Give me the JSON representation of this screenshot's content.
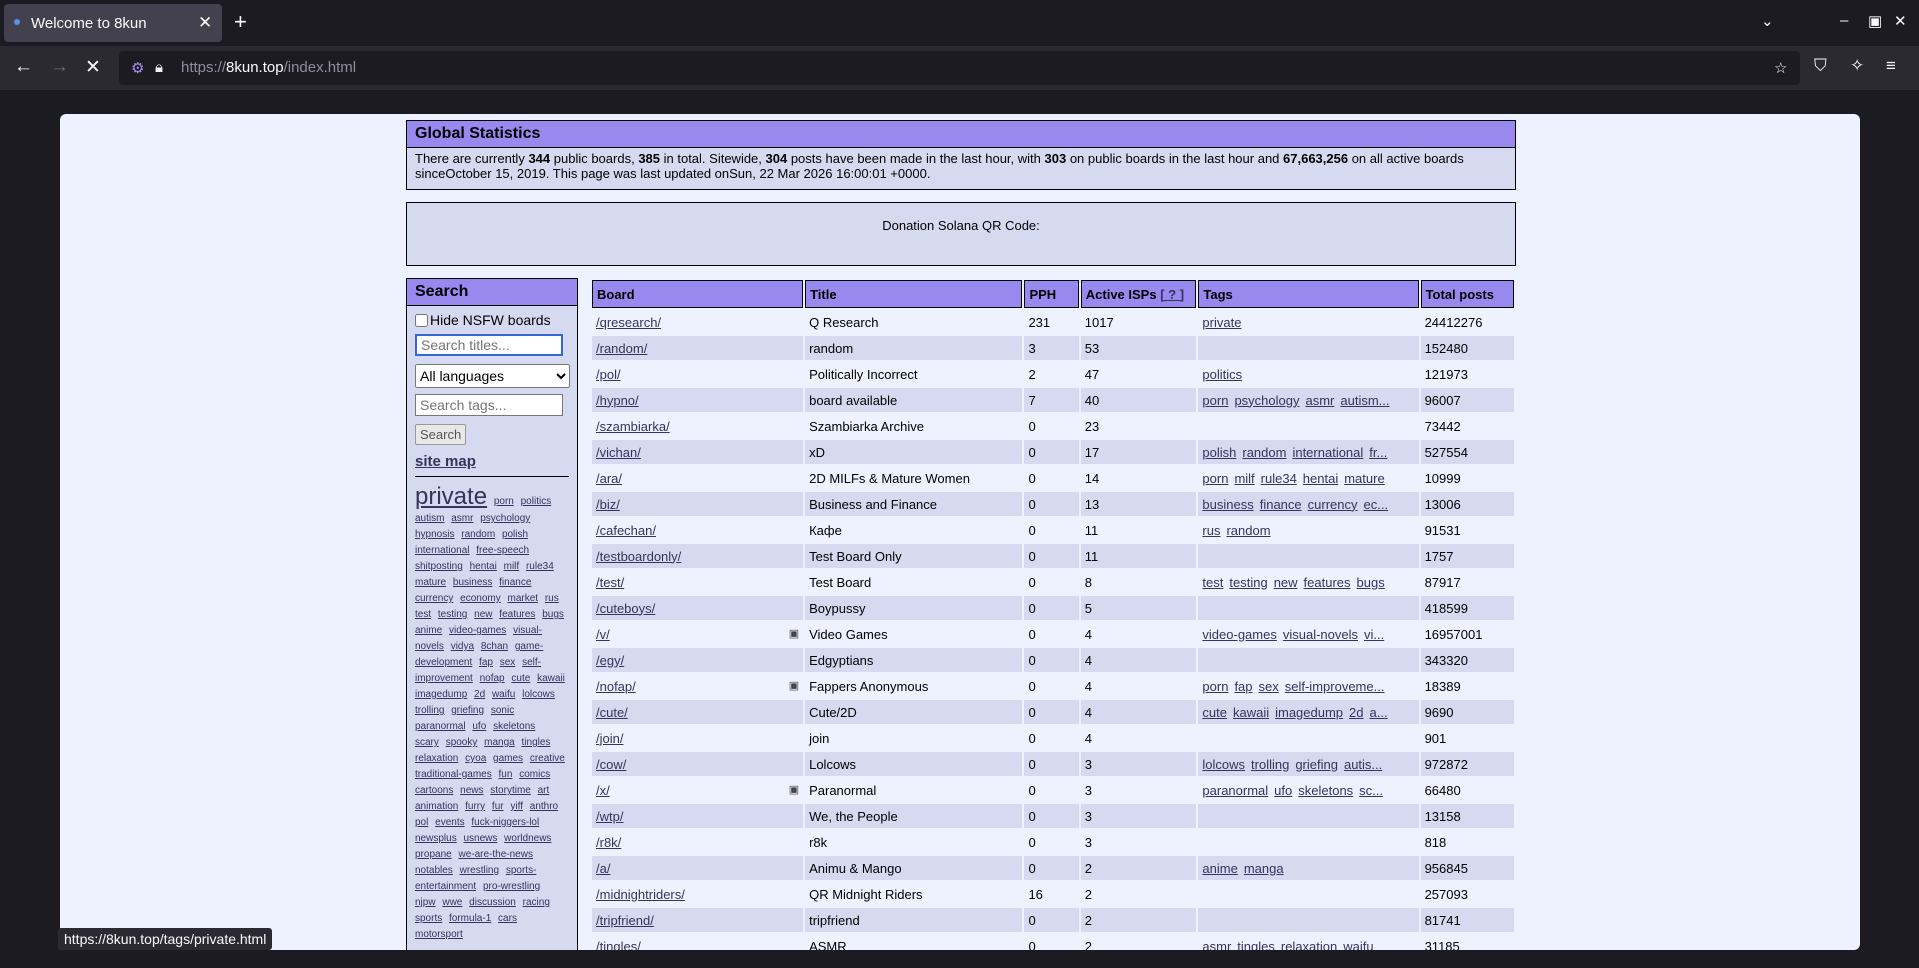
{
  "browser": {
    "tab_title": "Welcome to 8kun",
    "url_prefix": "https://",
    "url_host": "8kun.top",
    "url_path": "/index.html",
    "status_url": "https://8kun.top/tags/private.html"
  },
  "stats": {
    "heading": "Global Statistics",
    "t1": "There are currently ",
    "public_boards": "344",
    "t2": " public boards, ",
    "total_boards": "385",
    "t3": " in total. Sitewide, ",
    "posts_hour": "304",
    "t4": " posts have been made in the last hour, with ",
    "public_hour": "303",
    "t5": " on public boards in the last hour and ",
    "all_posts": "67,663,256",
    "t6": " on all active boards sinceOctober 15, 2019. This page was last updated onSun, 22 Mar 2026 16:00:01 +0000."
  },
  "donation": {
    "text": "Donation Solana QR Code:"
  },
  "search": {
    "heading": "Search",
    "hide_nsfw": "Hide NSFW boards",
    "title_placeholder": "Search titles...",
    "language": "All languages",
    "tags_placeholder": "Search tags...",
    "button": "Search",
    "site_map": "site map",
    "tags": [
      "porn",
      "politics",
      "autism",
      "asmr",
      "psychology",
      "hypnosis",
      "random",
      "polish",
      "international",
      "free-speech",
      "shitposting",
      "hentai",
      "milf",
      "rule34",
      "mature",
      "business",
      "finance",
      "currency",
      "economy",
      "market",
      "rus",
      "test",
      "testing",
      "new",
      "features",
      "bugs",
      "anime",
      "video-games",
      "visual-novels",
      "vidya",
      "8chan",
      "game-development",
      "fap",
      "sex",
      "self-improvement",
      "nofap",
      "cute",
      "kawaii",
      "imagedump",
      "2d",
      "waifu",
      "lolcows",
      "trolling",
      "griefing",
      "sonic",
      "paranormal",
      "ufo",
      "skeletons",
      "scary",
      "spooky",
      "manga",
      "tingles",
      "relaxation",
      "cyoa",
      "games",
      "creative",
      "traditional-games",
      "fun",
      "comics",
      "cartoons",
      "news",
      "storytime",
      "art",
      "animation",
      "furry",
      "fur",
      "yiff",
      "anthro",
      "pol",
      "events",
      "fuck-niggers-lol",
      "newsplus",
      "usnews",
      "worldnews",
      "propane",
      "we-are-the-news",
      "notables",
      "wrestling",
      "sports-entertainment",
      "pro-wrestling",
      "njpw",
      "wwe",
      "discussion",
      "racing",
      "sports",
      "formula-1",
      "cars",
      "motorsport"
    ],
    "big_tag": "private"
  },
  "table": {
    "headers": [
      "Board",
      "Title",
      "PPH",
      "Active ISPs",
      "Tags",
      "Total posts"
    ],
    "isp_help": "[ ? ]",
    "rows": [
      {
        "board": "/qresearch/",
        "title": "Q Research",
        "pph": "231",
        "isps": "1017",
        "tags": [
          "private"
        ],
        "posts": "24412276"
      },
      {
        "board": "/random/",
        "title": "random",
        "pph": "3",
        "isps": "53",
        "tags": [],
        "posts": "152480"
      },
      {
        "board": "/pol/",
        "title": "Politically Incorrect",
        "pph": "2",
        "isps": "47",
        "tags": [
          "politics"
        ],
        "posts": "121973"
      },
      {
        "board": "/hypno/",
        "title": "board available",
        "pph": "7",
        "isps": "40",
        "tags": [
          "porn",
          "psychology",
          "asmr",
          "autism..."
        ],
        "posts": "96007"
      },
      {
        "board": "/szambiarka/",
        "title": "Szambiarka Archive",
        "pph": "0",
        "isps": "23",
        "tags": [],
        "posts": "73442"
      },
      {
        "board": "/vichan/",
        "title": "xD",
        "pph": "0",
        "isps": "17",
        "tags": [
          "polish",
          "random",
          "international",
          "fr..."
        ],
        "posts": "527554"
      },
      {
        "board": "/ara/",
        "title": "2D MILFs & Mature Women",
        "pph": "0",
        "isps": "14",
        "tags": [
          "porn",
          "milf",
          "rule34",
          "hentai",
          "mature"
        ],
        "posts": "10999"
      },
      {
        "board": "/biz/",
        "title": "Business and Finance",
        "pph": "0",
        "isps": "13",
        "tags": [
          "business",
          "finance",
          "currency",
          "ec..."
        ],
        "posts": "13006"
      },
      {
        "board": "/cafechan/",
        "title": "Кафе",
        "pph": "0",
        "isps": "11",
        "tags": [
          "rus",
          "random"
        ],
        "posts": "91531"
      },
      {
        "board": "/testboardonly/",
        "title": "Test Board Only",
        "pph": "0",
        "isps": "11",
        "tags": [],
        "posts": "1757"
      },
      {
        "board": "/test/",
        "title": "Test Board",
        "pph": "0",
        "isps": "8",
        "tags": [
          "test",
          "testing",
          "new",
          "features",
          "bugs"
        ],
        "posts": "87917"
      },
      {
        "board": "/cuteboys/",
        "title": "Boypussy",
        "pph": "0",
        "isps": "5",
        "tags": [],
        "posts": "418599"
      },
      {
        "board": "/v/",
        "title": "Video Games",
        "pph": "0",
        "isps": "4",
        "tags": [
          "video-games",
          "visual-novels",
          "vi..."
        ],
        "posts": "16957001",
        "sfw": true
      },
      {
        "board": "/egy/",
        "title": "Edgyptians",
        "pph": "0",
        "isps": "4",
        "tags": [],
        "posts": "343320"
      },
      {
        "board": "/nofap/",
        "title": "Fappers Anonymous",
        "pph": "0",
        "isps": "4",
        "tags": [
          "porn",
          "fap",
          "sex",
          "self-improveme..."
        ],
        "posts": "18389",
        "sfw": true
      },
      {
        "board": "/cute/",
        "title": "Cute/2D",
        "pph": "0",
        "isps": "4",
        "tags": [
          "cute",
          "kawaii",
          "imagedump",
          "2d",
          "a..."
        ],
        "posts": "9690"
      },
      {
        "board": "/join/",
        "title": "join",
        "pph": "0",
        "isps": "4",
        "tags": [],
        "posts": "901"
      },
      {
        "board": "/cow/",
        "title": "Lolcows",
        "pph": "0",
        "isps": "3",
        "tags": [
          "lolcows",
          "trolling",
          "griefing",
          "autis..."
        ],
        "posts": "972872"
      },
      {
        "board": "/x/",
        "title": "Paranormal",
        "pph": "0",
        "isps": "3",
        "tags": [
          "paranormal",
          "ufo",
          "skeletons",
          "sc..."
        ],
        "posts": "66480",
        "sfw": true
      },
      {
        "board": "/wtp/",
        "title": "We, the People",
        "pph": "0",
        "isps": "3",
        "tags": [],
        "posts": "13158"
      },
      {
        "board": "/r8k/",
        "title": "r8k",
        "pph": "0",
        "isps": "3",
        "tags": [],
        "posts": "818"
      },
      {
        "board": "/a/",
        "title": "Animu & Mango",
        "pph": "0",
        "isps": "2",
        "tags": [
          "anime",
          "manga"
        ],
        "posts": "956845"
      },
      {
        "board": "/midnightriders/",
        "title": "QR Midnight Riders",
        "pph": "16",
        "isps": "2",
        "tags": [],
        "posts": "257093"
      },
      {
        "board": "/tripfriend/",
        "title": "tripfriend",
        "pph": "0",
        "isps": "2",
        "tags": [],
        "posts": "81741"
      },
      {
        "board": "/tingles/",
        "title": "ASMR",
        "pph": "0",
        "isps": "2",
        "tags": [
          "asmr",
          "tingles",
          "relaxation",
          "waifu"
        ],
        "posts": "31185"
      }
    ]
  }
}
